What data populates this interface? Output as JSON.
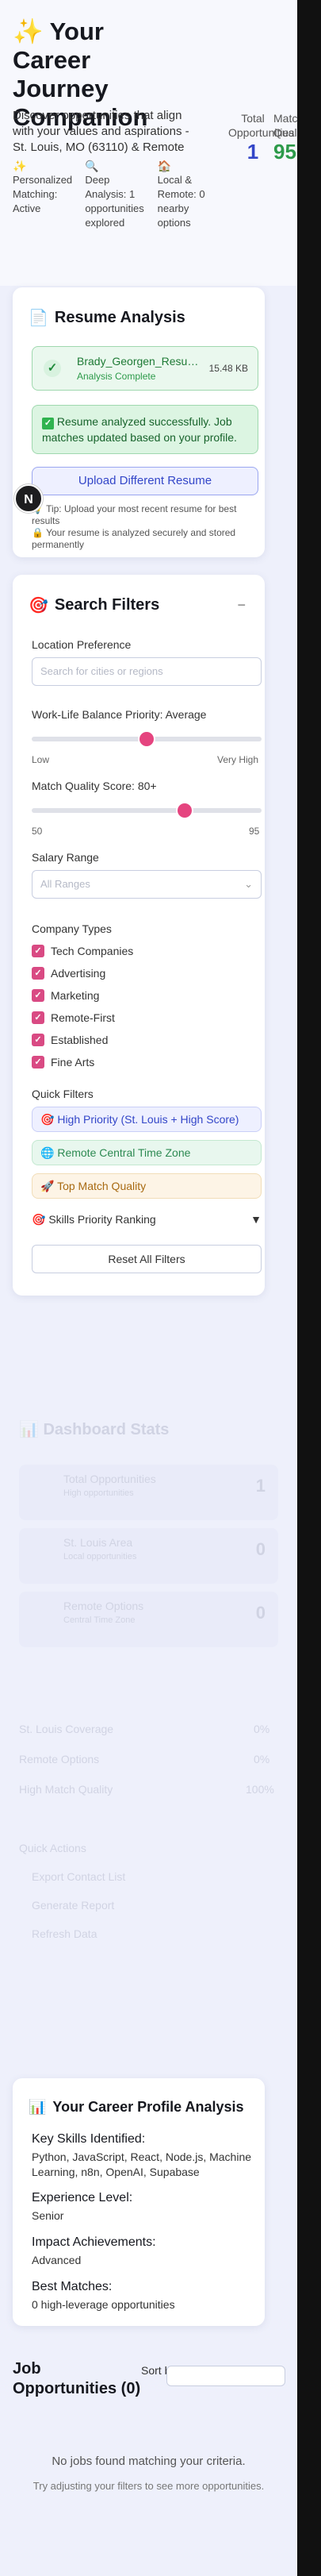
{
  "header": {
    "icon": "sparkle-icon",
    "title": "Your Career Journey Companion",
    "subtitle": "Discover opportunities that align with your values and aspirations - St. Louis, MO (63110) & Remote",
    "features": [
      {
        "icon": "sparkles-icon",
        "text": "Personalized Matching: Active"
      },
      {
        "icon": "magnifier-icon",
        "text": "Deep Analysis: 1 opportunities explored"
      },
      {
        "icon": "house-icon",
        "text": "Local & Remote: 0 nearby options"
      }
    ],
    "stats": [
      {
        "label": "Total Opportunities",
        "value": "1",
        "color": "#3346c8"
      },
      {
        "label": "Match Quality",
        "value": "95",
        "color": "#2d9a4a"
      }
    ]
  },
  "resume": {
    "icon": "document-icon",
    "title": "Resume Analysis",
    "file_name": "Brady_Georgen_Resume.pdf",
    "file_status": "Analysis Complete",
    "file_size": "15.48 KB",
    "success": "Resume analyzed successfully. Job matches updated based on your profile.",
    "upload_label": "Upload Different Resume",
    "tip": "Tip: Upload your most recent resume for best results",
    "secure": "Your resume is analyzed securely and stored permanently"
  },
  "filters": {
    "icon": "target-icon",
    "title": "Search Filters",
    "collapse": "−",
    "location_label": "Location Preference",
    "location_placeholder": "Search for cities or regions",
    "wlb_label": "Work-Life Balance Priority: Average",
    "wlb_low": "Low",
    "wlb_high": "Very High",
    "wlb_value_fraction": 0.5,
    "match_label": "Match Quality Score: 80+",
    "match_min": "50",
    "match_max": "95",
    "match_value": 80,
    "salary_label": "Salary Range",
    "salary_value": "All Ranges",
    "company_label": "Company Types",
    "company_types": [
      "Tech Companies",
      "Advertising",
      "Marketing",
      "Remote-First",
      "Established",
      "Fine Arts"
    ],
    "quick_label": "Quick Filters",
    "quick_filters": [
      {
        "icon": "target-icon",
        "text": "High Priority (St. Louis + High Score)"
      },
      {
        "icon": "globe-icon",
        "text": "Remote Central Time Zone"
      },
      {
        "icon": "rocket-icon",
        "text": "Top Match Quality"
      }
    ],
    "skills_label": "Skills Priority Ranking",
    "reset_label": "Reset All Filters"
  },
  "dashboard": {
    "title": "Dashboard Stats",
    "cards": [
      {
        "label": "Total Opportunities",
        "sub": "High opportunities",
        "value": "1"
      },
      {
        "label": "St. Louis Area",
        "sub": "Local opportunities",
        "value": "0"
      },
      {
        "label": "Remote Options",
        "sub": "Central Time Zone",
        "value": "0"
      }
    ],
    "progress": [
      {
        "label": "St. Louis Coverage",
        "value": "0%"
      },
      {
        "label": "Remote Options",
        "value": "0%"
      },
      {
        "label": "High Match Quality",
        "value": "100%"
      }
    ],
    "actions_title": "Quick Actions",
    "actions": [
      "Export Contact List",
      "Generate Report",
      "Refresh Data"
    ]
  },
  "profile": {
    "icon": "chart-icon",
    "title": "Your Career Profile Analysis",
    "skills_label": "Key Skills Identified:",
    "skills": "Python, JavaScript, React, Node.js, Machine Learning, n8n, OpenAI, Supabase",
    "experience_label": "Experience Level:",
    "experience": "Senior",
    "impact_label": "Impact Achievements:",
    "impact": "Advanced",
    "best_label": "Best Matches:",
    "best": "0 high-leverage opportunities"
  },
  "jobs": {
    "title": "Job Opportunities (0)",
    "sort_label": "Sort by:",
    "empty_title": "No jobs found matching your criteria.",
    "empty_sub": "Try adjusting your filters to see more opportunities."
  },
  "badge": "N"
}
